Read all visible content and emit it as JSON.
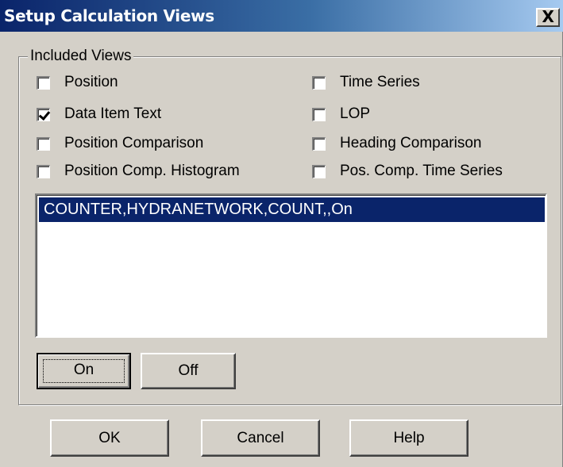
{
  "window": {
    "title": "Setup Calculation Views",
    "close_glyph": "X"
  },
  "group": {
    "legend": "Included Views"
  },
  "checkboxes": [
    {
      "label": "Position",
      "checked": false
    },
    {
      "label": "Time Series",
      "checked": false
    },
    {
      "label": "Data Item Text",
      "checked": true
    },
    {
      "label": "LOP",
      "checked": false
    },
    {
      "label": "Position Comparison",
      "checked": false
    },
    {
      "label": "Heading Comparison",
      "checked": false
    },
    {
      "label": "Position Comp. Histogram",
      "checked": false
    },
    {
      "label": "Pos. Comp. Time Series",
      "checked": false
    }
  ],
  "list": {
    "items": [
      "COUNTER,HYDRANETWORK,COUNT,,On"
    ],
    "selected_index": 0,
    "selection_color": "#0a246a"
  },
  "toggle_buttons": {
    "on_label": "On",
    "off_label": "Off"
  },
  "footer_buttons": {
    "ok_label": "OK",
    "cancel_label": "Cancel",
    "help_label": "Help"
  },
  "colors": {
    "face": "#d4d0c8",
    "title_start": "#0a246a",
    "title_end": "#a6caf0"
  }
}
